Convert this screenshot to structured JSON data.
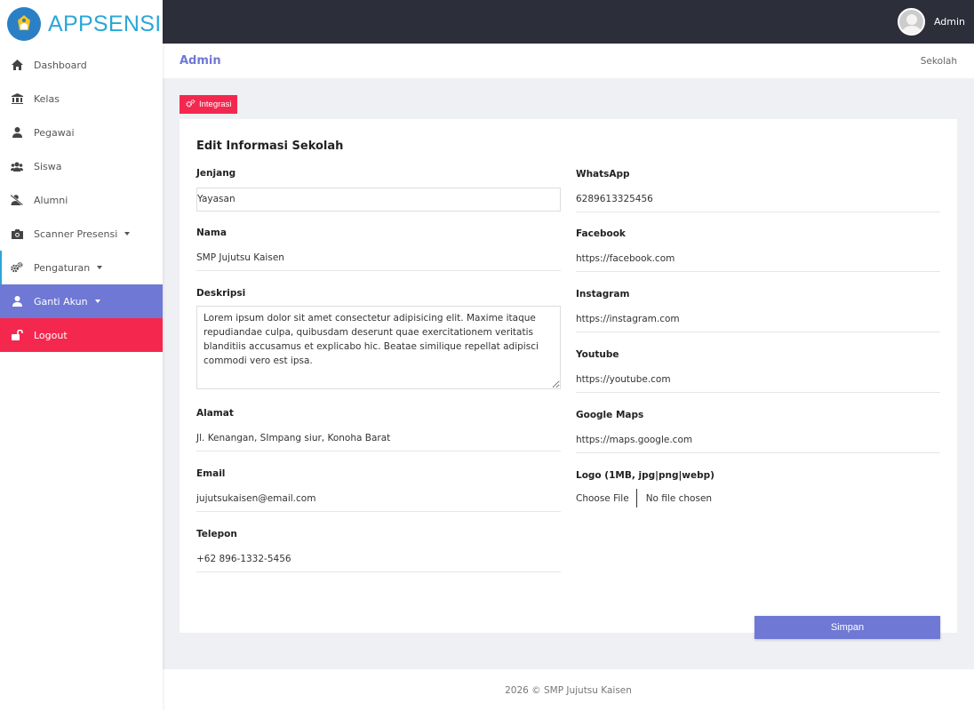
{
  "brand": {
    "name": "APPSENSI"
  },
  "sidebar": {
    "items": [
      {
        "label": "Dashboard"
      },
      {
        "label": "Kelas"
      },
      {
        "label": "Pegawai"
      },
      {
        "label": "Siswa"
      },
      {
        "label": "Alumni"
      },
      {
        "label": "Scanner Presensi"
      },
      {
        "label": "Pengaturan"
      },
      {
        "label": "Ganti Akun"
      },
      {
        "label": "Logout"
      }
    ]
  },
  "topbar": {
    "user": "Admin"
  },
  "header": {
    "title": "Admin",
    "breadcrumb": "Sekolah"
  },
  "integrasi": {
    "label": "Integrasi"
  },
  "form": {
    "title": "Edit Informasi Sekolah",
    "jenjang": {
      "label": "Jenjang",
      "value": "Yayasan"
    },
    "nama": {
      "label": "Nama",
      "value": "SMP Jujutsu Kaisen"
    },
    "deskripsi": {
      "label": "Deskripsi",
      "value": "Lorem ipsum dolor sit amet consectetur adipisicing elit. Maxime itaque repudiandae culpa, quibusdam deserunt quae exercitationem veritatis blanditiis accusamus et explicabo hic. Beatae similique repellat adipisci commodi vero est ipsa."
    },
    "alamat": {
      "label": "Alamat",
      "value": "Jl. Kenangan, SImpang siur, Konoha Barat"
    },
    "email": {
      "label": "Email",
      "value": "jujutsukaisen@email.com"
    },
    "telepon": {
      "label": "Telepon",
      "value": "+62 896-1332-5456"
    },
    "whatsapp": {
      "label": "WhatsApp",
      "value": "6289613325456"
    },
    "facebook": {
      "label": "Facebook",
      "value": "https://facebook.com"
    },
    "instagram": {
      "label": "Instagram",
      "value": "https://instagram.com"
    },
    "youtube": {
      "label": "Youtube",
      "value": "https://youtube.com"
    },
    "maps": {
      "label": "Google Maps",
      "value": "https://maps.google.com"
    },
    "logo": {
      "label": "Logo (1MB, jpg|png|webp)",
      "button": "Choose File",
      "status": "No file chosen"
    },
    "submit": "Simpan"
  },
  "footer": {
    "text": "2026 © SMP Jujutsu Kaisen"
  },
  "colors": {
    "primary": "#6f78d4",
    "danger": "#f4284f",
    "topbar": "#2c2e3a",
    "brand": "#2aa7d8"
  }
}
